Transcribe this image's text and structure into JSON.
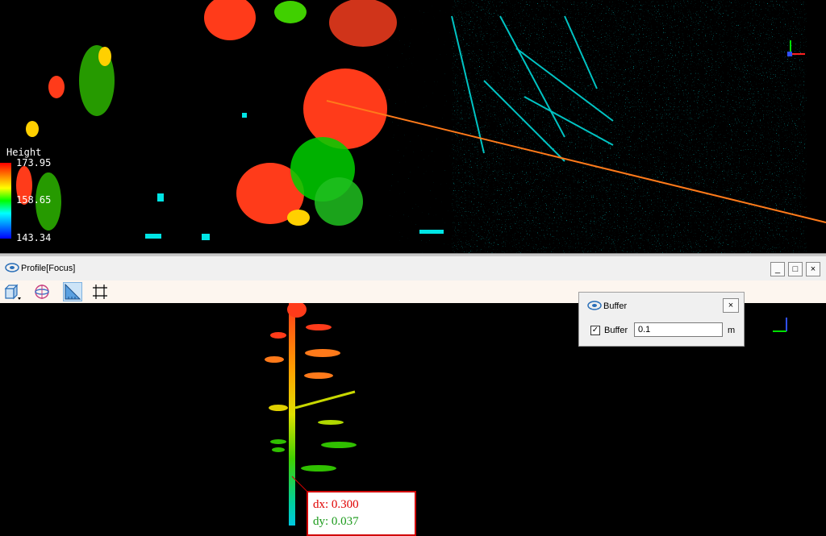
{
  "top_view": {
    "legend": {
      "title": "Height",
      "max": "173.95",
      "mid": "158.65",
      "min": "143.34"
    },
    "colors": {
      "high": "#ff3b1a",
      "mid": "#00e000",
      "low": "#00e5e5",
      "profile_line": "#ff7a1a"
    }
  },
  "profile_window": {
    "title": "Profile[Focus]",
    "window_buttons": {
      "minimize": "_",
      "maximize": "□",
      "close": "×"
    },
    "toolbar": {
      "tools": [
        "view-cube-icon",
        "orbit-icon",
        "ruler-measure-icon",
        "grid-select-icon"
      ],
      "active_tool": "ruler-measure-icon"
    }
  },
  "buffer_dialog": {
    "title": "Buffer",
    "close_label": "×",
    "checkbox_label": "Buffer",
    "checked": true,
    "check_mark": "✓",
    "value": "0.1",
    "unit": "m"
  },
  "measurement": {
    "dx": "dx: 0.300",
    "dy": "dy: 0.037"
  }
}
